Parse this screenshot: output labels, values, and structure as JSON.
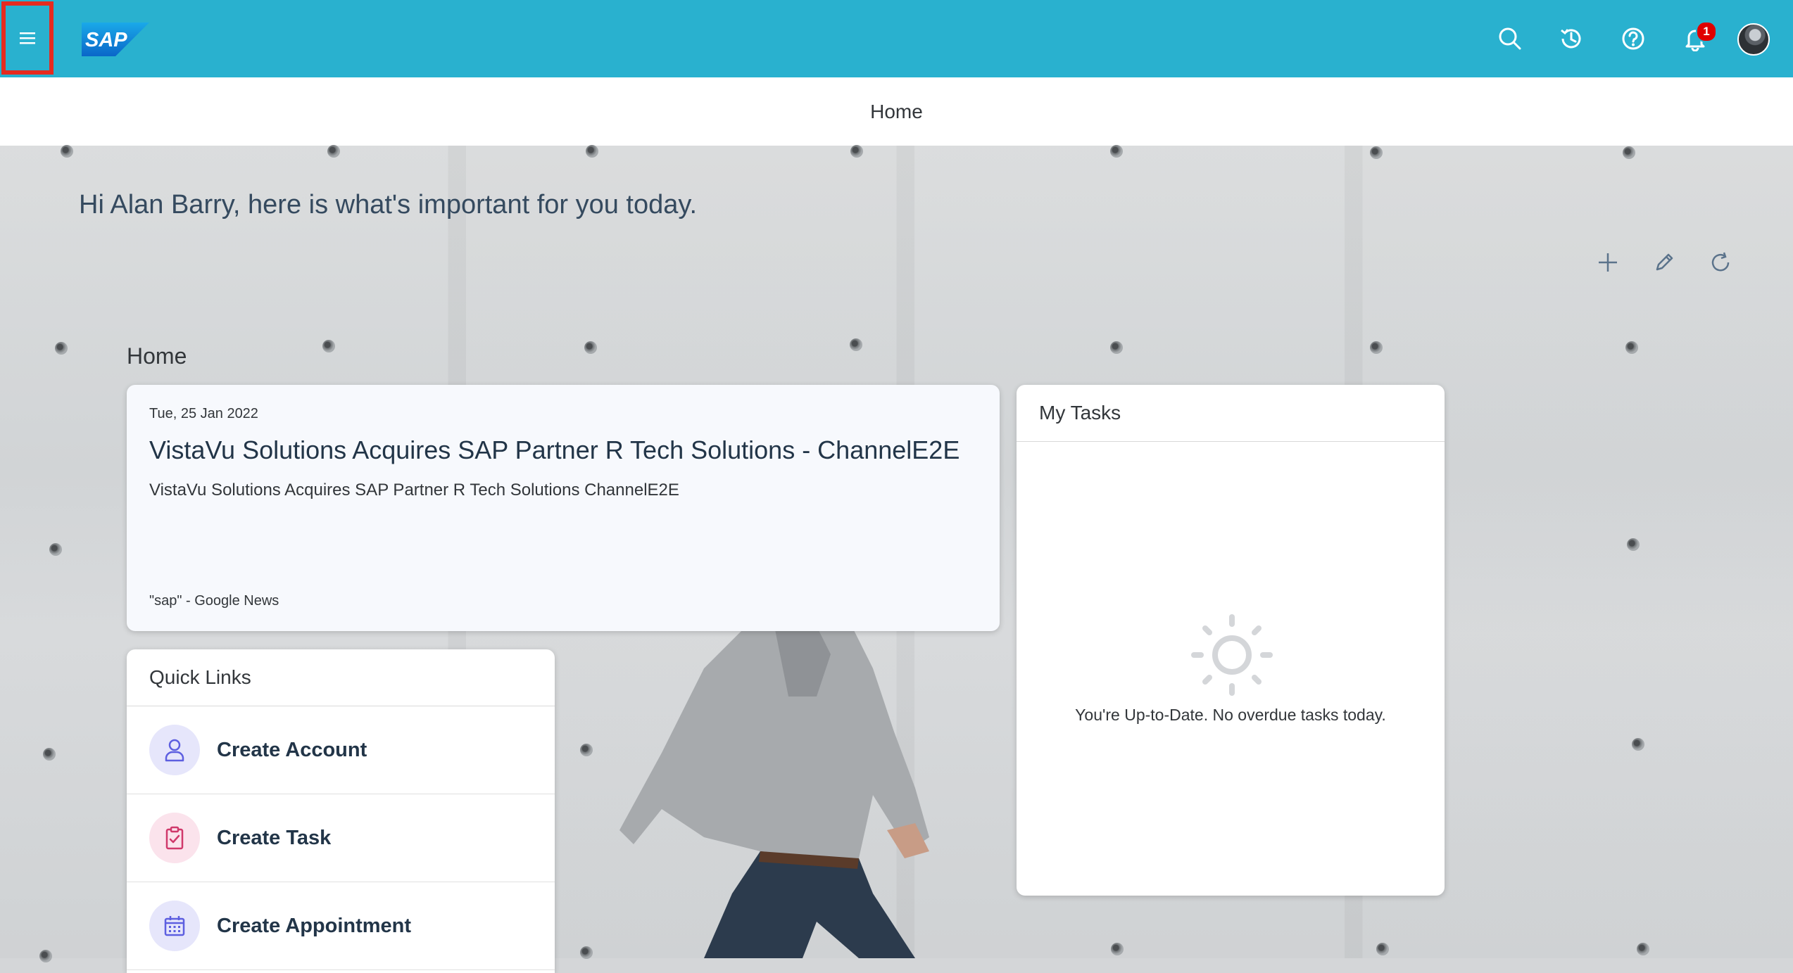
{
  "shellbar": {
    "logo_text": "SAP",
    "menu_icon": "hamburger-menu-icon",
    "icons": [
      "search-icon",
      "history-icon",
      "help-icon",
      "notification-bell-icon"
    ],
    "notification_count": "1",
    "colors": {
      "shell_background": "#29b1cf",
      "highlight_border": "#e52b1f",
      "badge": "#e00000"
    }
  },
  "titlebar": {
    "title": "Home"
  },
  "page": {
    "greeting": "Hi Alan Barry, here is what's important for you today.",
    "actions": [
      "add-icon",
      "edit-icon",
      "refresh-icon"
    ],
    "section_title": "Home"
  },
  "news_card": {
    "date": "Tue, 25 Jan 2022",
    "title": "VistaVu Solutions Acquires SAP Partner R Tech Solutions - ChannelE2E",
    "description": "VistaVu Solutions Acquires SAP Partner R Tech Solutions  ChannelE2E",
    "source": "\"sap\" - Google News"
  },
  "tasks_card": {
    "title": "My Tasks",
    "empty_text": "You're Up-to-Date. No overdue tasks today.",
    "empty_icon": "sun-icon"
  },
  "quick_links": {
    "title": "Quick Links",
    "items": [
      {
        "label": "Create Account",
        "icon": "person-icon",
        "color": "#5d5fe0"
      },
      {
        "label": "Create Task",
        "icon": "clipboard-check-icon",
        "color": "#d0396b"
      },
      {
        "label": "Create Appointment",
        "icon": "calendar-icon",
        "color": "#5d5fe0"
      }
    ]
  }
}
